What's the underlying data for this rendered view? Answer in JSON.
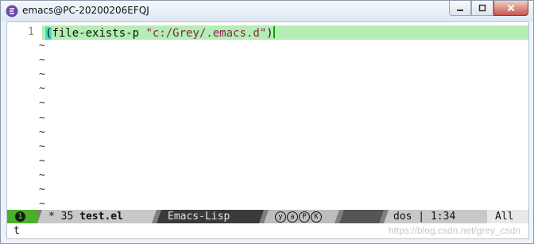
{
  "window": {
    "title": "emacs@PC-20200206EFQJ",
    "icon": "emacs-icon",
    "buttons": [
      "minimize-icon",
      "maximize-icon",
      "close-icon"
    ]
  },
  "editor": {
    "line_number": "1",
    "code_open": "(",
    "code_func": "file-exists-p ",
    "code_string": "\"c:/Grey/.emacs.d\"",
    "code_close": ")",
    "tilde": "~",
    "tilde_count": 12
  },
  "modeline": {
    "window_number": "1",
    "buffer_status": "* 35 ",
    "buffer_name": "test.el",
    "major_mode": "Emacs-Lisp",
    "minor_modes": [
      "y",
      "a",
      "P",
      "K"
    ],
    "eol": "dos",
    "position": "1:34",
    "scroll": "All"
  },
  "echo_area": {
    "text": "t"
  },
  "watermark": "https://blog.csdn.net/grey_csdn",
  "colors": {
    "line_highlight": "#b4eeb4",
    "string": "#8b2252",
    "modeline_accent": "#4caf2a"
  }
}
